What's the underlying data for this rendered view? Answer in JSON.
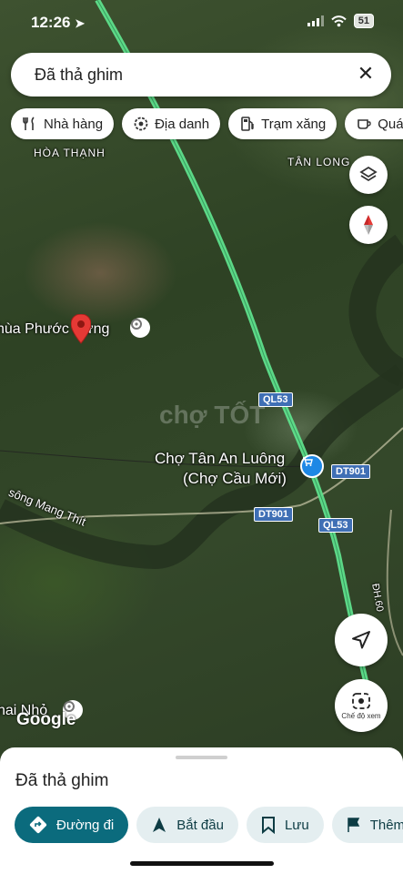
{
  "status": {
    "time": "12:26",
    "battery": "51"
  },
  "search": {
    "text": "Đã thả ghim"
  },
  "chips": [
    {
      "label": "Nhà hàng",
      "icon": "fork-knife-icon"
    },
    {
      "label": "Địa danh",
      "icon": "landmark-icon"
    },
    {
      "label": "Trạm xăng",
      "icon": "gas-station-icon"
    },
    {
      "label": "Quán",
      "icon": "coffee-cup-icon"
    }
  ],
  "map": {
    "labels": {
      "hoa_thanh": "HÒA THẠNH",
      "tan_long": "TÂN LONG",
      "pin_place": "hùa Phước Hưng",
      "market": "Chợ Tân An Luông",
      "market_alt": "(Chợ Cầu Mới)",
      "river": "sông Mang Thít",
      "bottom_place": "nai Nhỏ",
      "dh": "ĐH.60",
      "watermark": "chợ TỐT"
    },
    "roads": {
      "ql53_a": "QL53",
      "ql53_b": "QL53",
      "dt901_a": "DT901",
      "dt901_b": "DT901"
    },
    "google_logo": "Google",
    "street_view_label": "Chế độ xem",
    "highway_color": "#5fe08c"
  },
  "sheet": {
    "title": "Đã thả ghim",
    "actions": [
      {
        "label": "Đường đi",
        "icon": "directions-icon",
        "primary": true
      },
      {
        "label": "Bắt đầu",
        "icon": "navigation-arrow-icon",
        "primary": false
      },
      {
        "label": "Lưu",
        "icon": "bookmark-icon",
        "primary": false
      },
      {
        "label": "Thêm",
        "icon": "flag-icon",
        "primary": false
      }
    ]
  }
}
